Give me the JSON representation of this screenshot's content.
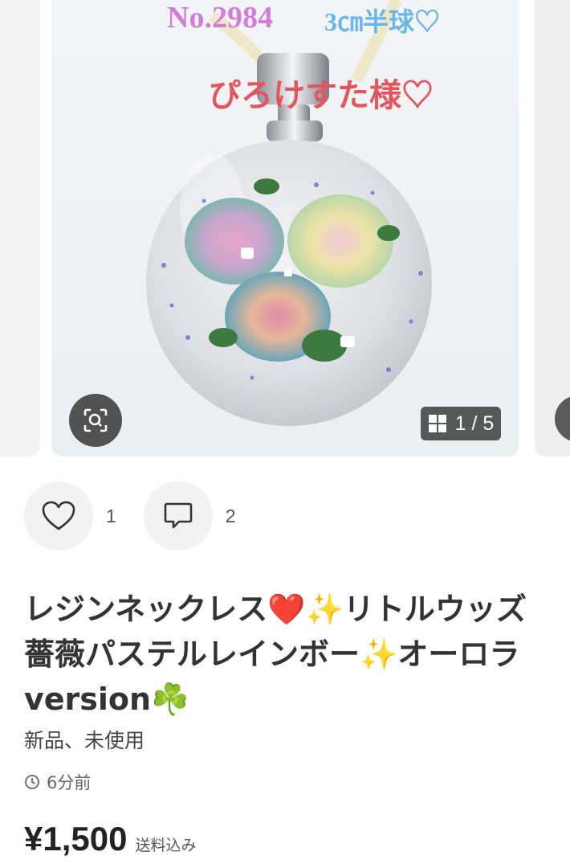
{
  "gallery": {
    "overlay_number": "No.2984",
    "overlay_size": "3㎝半球♡",
    "overlay_name": "ぴろけすた様♡",
    "counter": "1 / 5",
    "zoom_icon": "zoom-scan-icon",
    "grid_icon": "grid-icon"
  },
  "actions": {
    "like_count": "1",
    "comment_count": "2",
    "like_icon": "heart-icon",
    "comment_icon": "speech-bubble-icon"
  },
  "item": {
    "title": "レジンネックレス❤️✨リトルウッズ薔薇パステルレインボー✨オーロラversion☘️",
    "condition": "新品、未使用",
    "posted": "6分前",
    "price": "¥1,500",
    "shipping_note": "送料込み"
  },
  "colors": {
    "accent_pink": "#d27ed8",
    "accent_blue": "#6ab6ea",
    "accent_red": "#e2565e"
  }
}
